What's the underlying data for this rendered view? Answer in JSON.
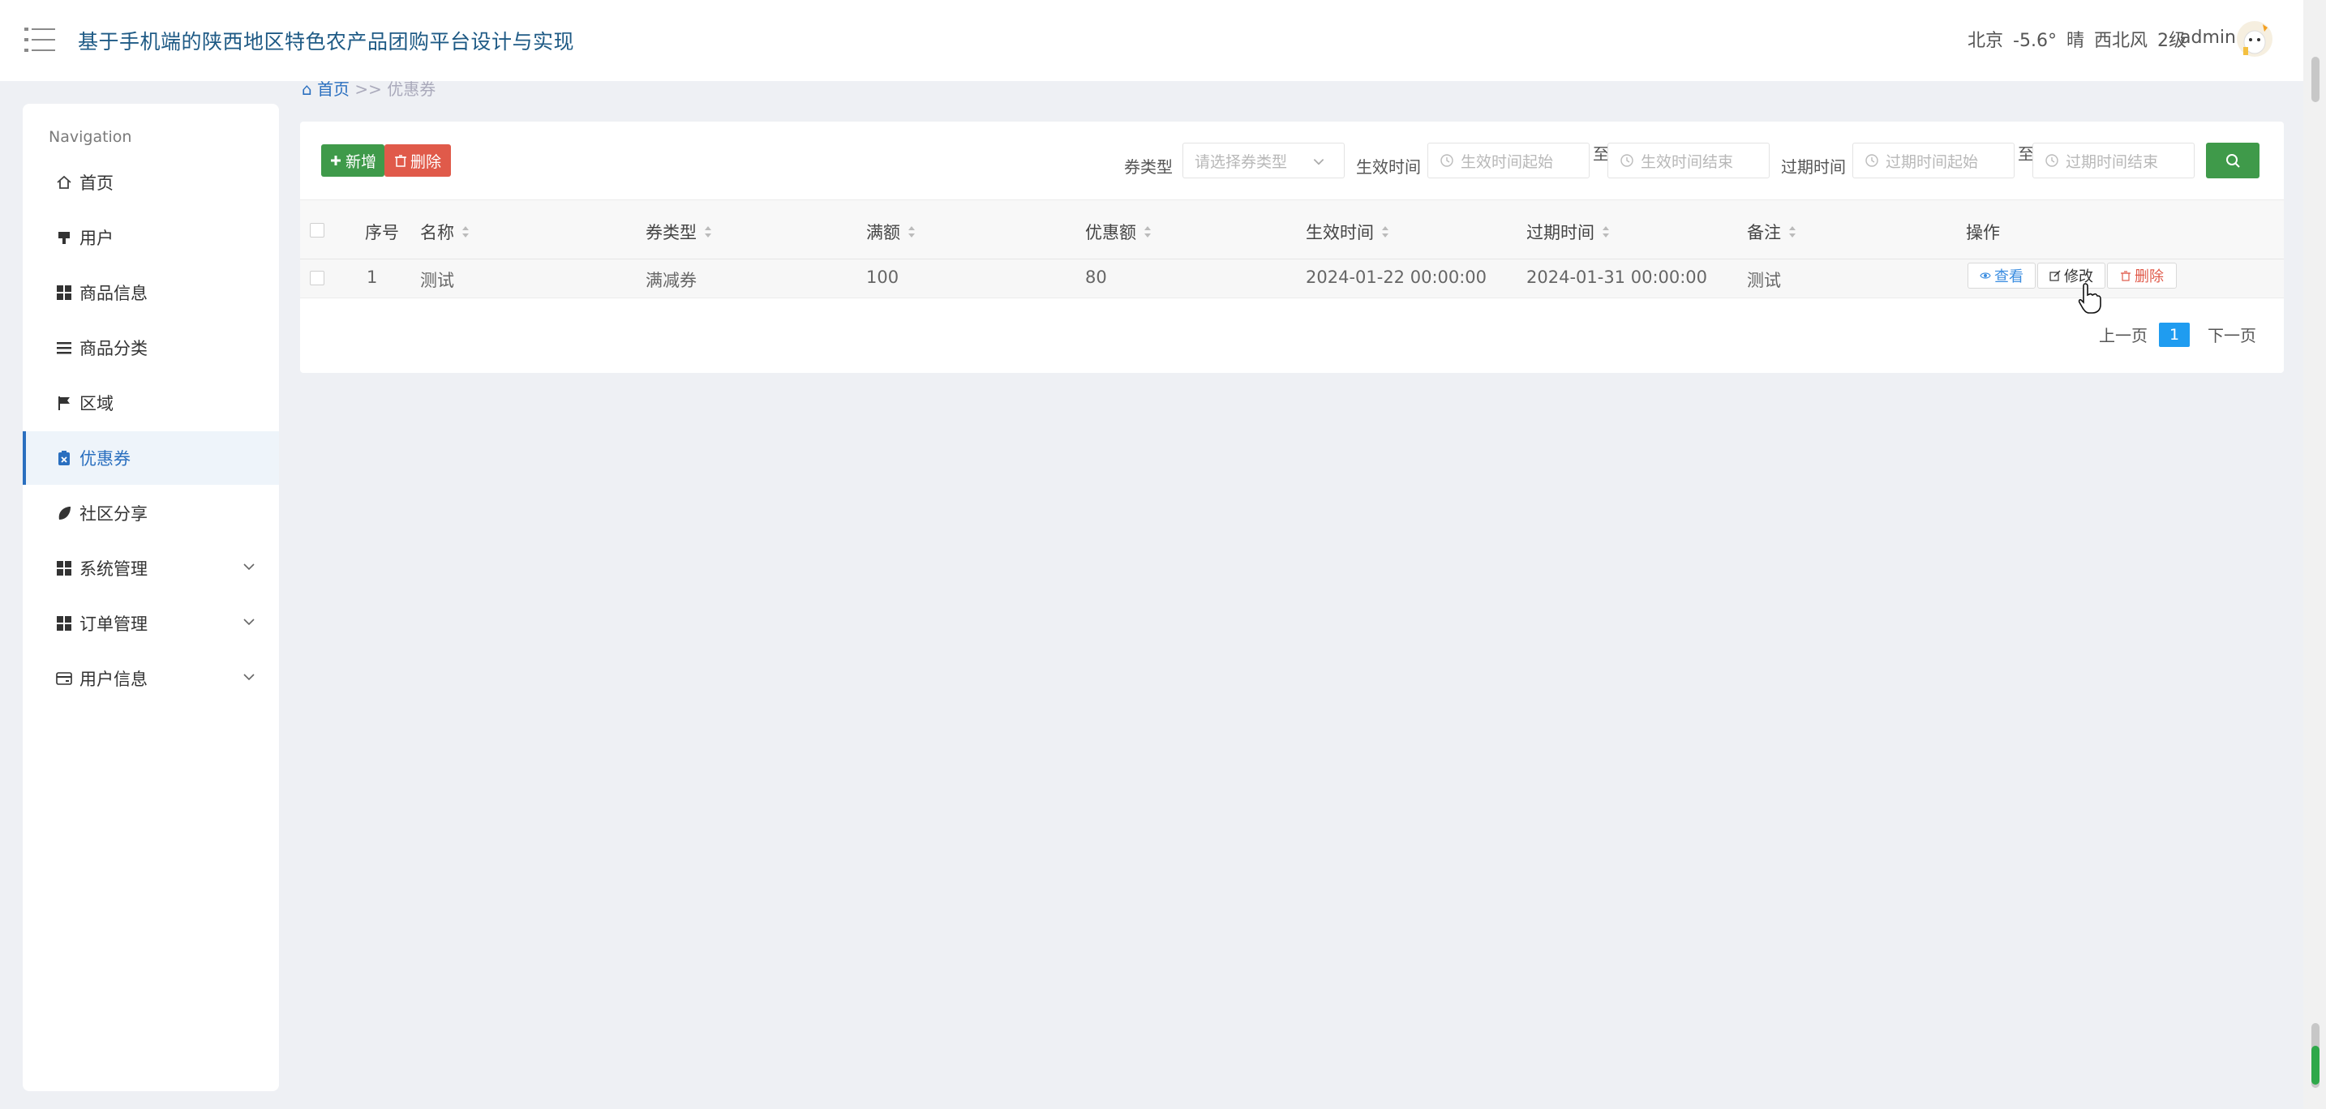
{
  "app": {
    "title": "基于手机端的陕西地区特色农产品团购平台设计与实现"
  },
  "header": {
    "weather": {
      "city": "北京",
      "temp": "-5.6°",
      "condition": "晴",
      "wind": "西北风",
      "level": "2级"
    },
    "username": "admin"
  },
  "sidebar": {
    "heading": "Navigation",
    "items": [
      {
        "label": "首页",
        "icon": "home-icon"
      },
      {
        "label": "用户",
        "icon": "user-icon"
      },
      {
        "label": "商品信息",
        "icon": "grid-icon"
      },
      {
        "label": "商品分类",
        "icon": "list-icon"
      },
      {
        "label": "区域",
        "icon": "flag-icon"
      },
      {
        "label": "优惠券",
        "icon": "coupon-icon",
        "active": true
      },
      {
        "label": "社区分享",
        "icon": "leaf-icon"
      },
      {
        "label": "系统管理",
        "icon": "grid-icon",
        "expandable": true
      },
      {
        "label": "订单管理",
        "icon": "grid-icon",
        "expandable": true
      },
      {
        "label": "用户信息",
        "icon": "card-icon",
        "expandable": true
      }
    ]
  },
  "breadcrumb": {
    "home": "首页",
    "separator": ">>",
    "current": "优惠券"
  },
  "toolbar": {
    "add_label": "新增",
    "delete_label": "删除"
  },
  "filters": {
    "type_label": "券类型",
    "type_placeholder": "请选择券类型",
    "effective_label": "生效时间",
    "effective_start_placeholder": "生效时间起始",
    "effective_end_placeholder": "生效时间结束",
    "expire_label": "过期时间",
    "expire_start_placeholder": "过期时间起始",
    "expire_end_placeholder": "过期时间结束",
    "range_sep": "至"
  },
  "table": {
    "columns": [
      "序号",
      "名称",
      "券类型",
      "满额",
      "优惠额",
      "生效时间",
      "过期时间",
      "备注",
      "操作"
    ],
    "rows": [
      {
        "index": "1",
        "name": "测试",
        "type": "满减券",
        "threshold": "100",
        "discount": "80",
        "effective": "2024-01-22 00:00:00",
        "expire": "2024-01-31 00:00:00",
        "remark": "测试"
      }
    ],
    "actions": {
      "view": "查看",
      "edit": "修改",
      "delete": "删除"
    }
  },
  "pagination": {
    "prev": "上一页",
    "current": "1",
    "next": "下一页"
  },
  "colors": {
    "accent_green": "#3f9a4a",
    "danger_red": "#e05a4a",
    "page_blue": "#1f9cf0",
    "title_blue": "#1e5a85"
  }
}
